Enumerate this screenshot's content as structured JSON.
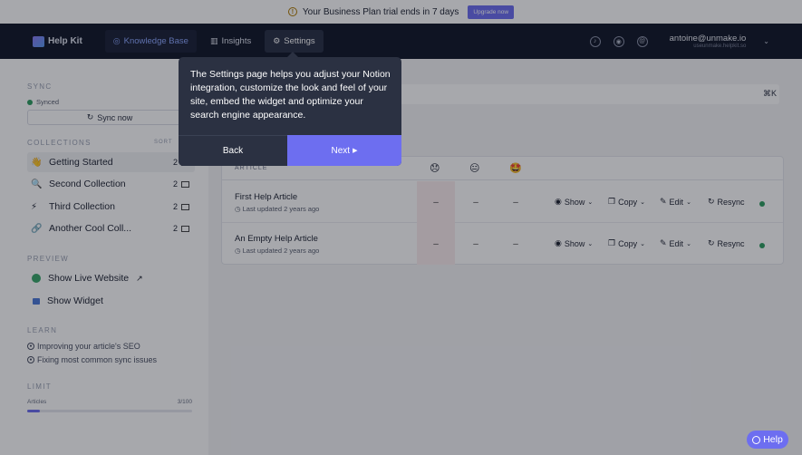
{
  "banner": {
    "text": "Your Business Plan trial ends in 7 days",
    "upgrade_label": "Upgrade now"
  },
  "nav": {
    "brand": "Help Kit",
    "tabs": [
      {
        "label": "Knowledge Base"
      },
      {
        "label": "Insights"
      },
      {
        "label": "Settings"
      }
    ],
    "user_email": "antoine@unmake.io",
    "user_sub": "useunmake.helpkit.so"
  },
  "sidebar": {
    "sync_title": "SYNC",
    "synced_label": "Synced",
    "sync_button": "Sync now",
    "collections_title": "COLLECTIONS",
    "sort_label": "SORT",
    "collections": [
      {
        "emoji": "👋",
        "label": "Getting Started",
        "count": "2"
      },
      {
        "emoji": "🔍",
        "label": "Second Collection",
        "count": "2"
      },
      {
        "emoji": "⚡",
        "label": "Third Collection",
        "count": "2"
      },
      {
        "emoji": "🔗",
        "label": "Another Cool Coll...",
        "count": "2"
      }
    ],
    "preview_title": "PREVIEW",
    "preview_items": [
      {
        "label": "Show Live Website"
      },
      {
        "label": "Show Widget"
      }
    ],
    "learn_title": "LEARN",
    "learn_items": [
      {
        "label": "Improving your article's SEO"
      },
      {
        "label": "Fixing most common sync issues"
      }
    ],
    "limit_title": "LIMIT",
    "limit_label": "Articles",
    "limit_value": "3/100",
    "limit_fraction": 0.03
  },
  "main": {
    "shortcut": "⌘K",
    "article_header": "ARTICLE",
    "feedback_emojis": [
      "😞",
      "😐",
      "🤩"
    ],
    "rows": [
      {
        "title": "First Help Article",
        "updated": "Last updated 2 years ago",
        "fb": [
          "–",
          "–",
          "–"
        ]
      },
      {
        "title": "An Empty Help Article",
        "updated": "Last updated 2 years ago",
        "fb": [
          "–",
          "–",
          "–"
        ]
      }
    ],
    "actions": {
      "show": "Show",
      "copy": "Copy",
      "edit": "Edit",
      "resync": "Resync"
    }
  },
  "tooltip": {
    "text": "The Settings page helps you adjust your Notion integration, customize the look and feel of your site, embed the widget and optimize your search engine appearance.",
    "back_label": "Back",
    "next_label": "Next"
  },
  "help_label": "Help",
  "colors": {
    "accent": "#6d6ef0",
    "nav_bg": "#12182a",
    "tooltip_bg": "#2b3142",
    "success": "#2f9e62"
  }
}
